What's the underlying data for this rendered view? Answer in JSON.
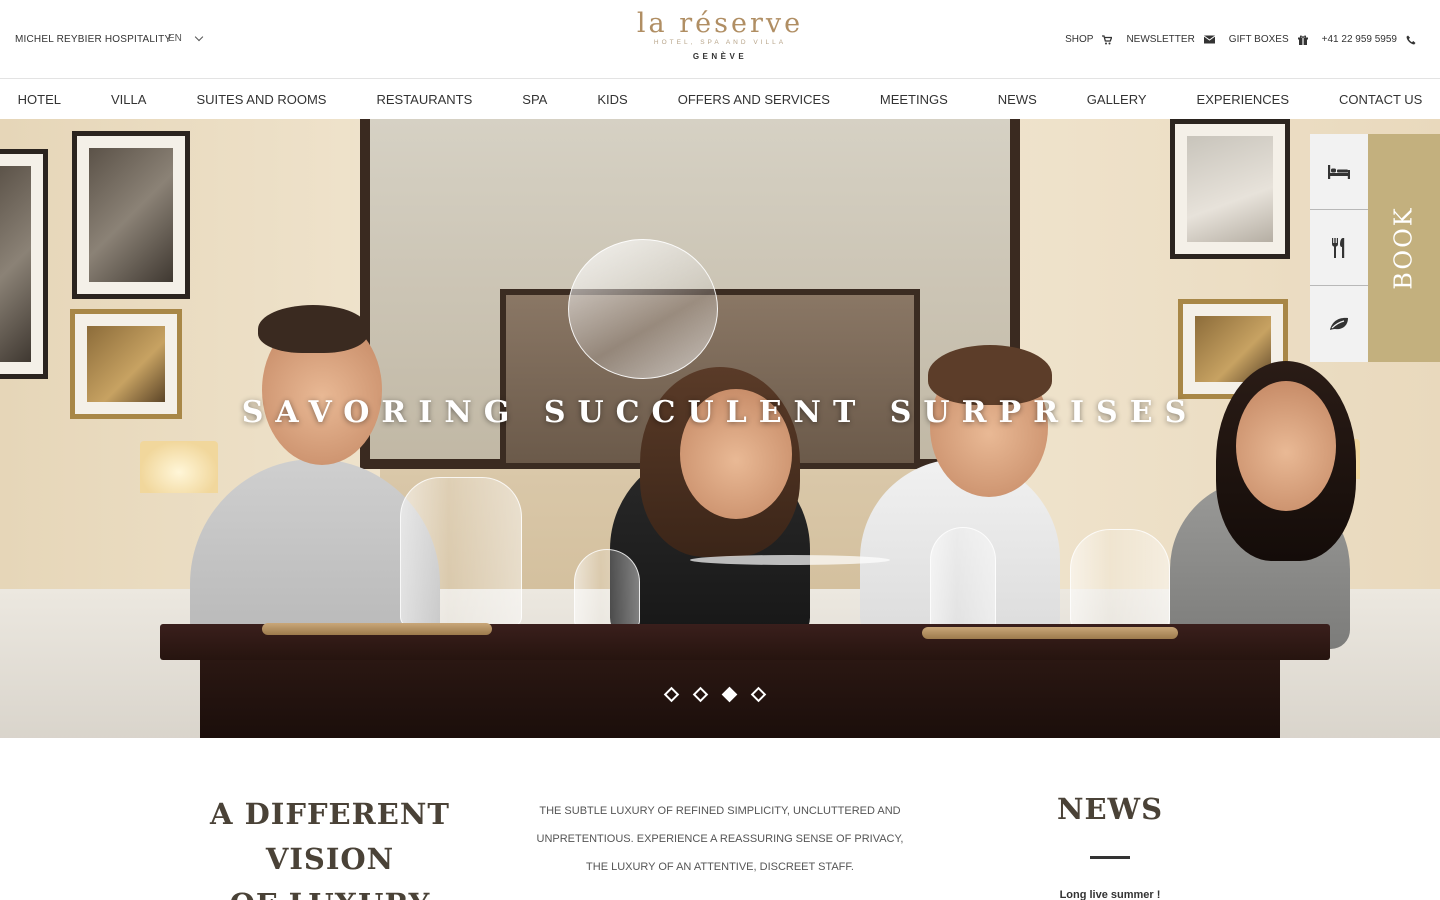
{
  "topbar": {
    "group_name": "MICHEL REYBIER HOSPITALITY",
    "language": "EN"
  },
  "logo": {
    "wordmark": "la réserve",
    "tagline": "HOTEL, SPA AND VILLA",
    "city": "GENÈVE"
  },
  "utility": {
    "shop": "SHOP",
    "newsletter": "NEWSLETTER",
    "gift_boxes": "GIFT BOXES",
    "phone": "+41 22 959 5959"
  },
  "nav": {
    "items": [
      "HOTEL",
      "VILLA",
      "SUITES AND ROOMS",
      "RESTAURANTS",
      "SPA",
      "KIDS",
      "OFFERS AND SERVICES",
      "MEETINGS",
      "NEWS",
      "GALLERY",
      "EXPERIENCES",
      "CONTACT US"
    ]
  },
  "hero": {
    "title": "SAVORING SUCCULENT SURPRISES",
    "slide_count": 4,
    "active_slide": 3
  },
  "booking": {
    "label": "BOOK",
    "icons": [
      "bed-icon",
      "cutlery-icon",
      "leaf-icon"
    ],
    "accent_color": "#c3b07e"
  },
  "intro": {
    "heading_line1": "A DIFFERENT VISION",
    "heading_line2": "OF LUXURY",
    "text_line1": "THE SUBTLE LUXURY OF REFINED SIMPLICITY, UNCLUTTERED AND",
    "text_line2": "UNPRETENTIOUS. EXPERIENCE A REASSURING SENSE OF PRIVACY,",
    "text_line3": "THE LUXURY OF AN ATTENTIVE, DISCREET STAFF."
  },
  "news": {
    "heading": "NEWS",
    "first_item": "Long live summer !"
  },
  "colors": {
    "brand_gold": "#b08e63",
    "heading_text": "#4a4237"
  }
}
